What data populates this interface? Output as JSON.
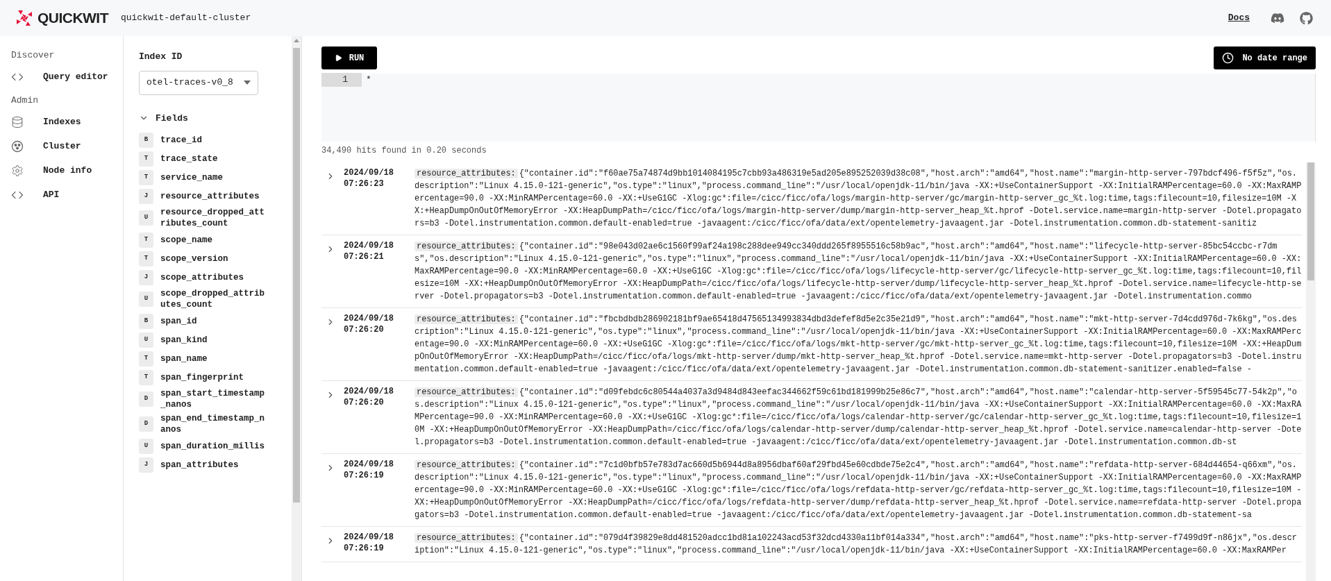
{
  "header": {
    "brand": "QUICKWIT",
    "cluster": "quickwit-default-cluster",
    "docs": "Docs"
  },
  "nav": [
    {
      "title": "Discover",
      "items": [
        {
          "label": "Query editor"
        }
      ]
    },
    {
      "title": "Admin",
      "items": [
        {
          "label": "Indexes"
        },
        {
          "label": "Cluster"
        },
        {
          "label": "Node info"
        },
        {
          "label": "API"
        }
      ]
    }
  ],
  "index_panel": {
    "label": "Index ID",
    "value": "otel-traces-v0_8",
    "fields_title": "Fields",
    "fields_expanded": true,
    "fields": [
      {
        "type": "B",
        "name": "trace_id"
      },
      {
        "type": "T",
        "name": "trace_state"
      },
      {
        "type": "T",
        "name": "service_name"
      },
      {
        "type": "J",
        "name": "resource_attributes"
      },
      {
        "type": "U",
        "name": "resource_dropped_attributes_count"
      },
      {
        "type": "T",
        "name": "scope_name"
      },
      {
        "type": "T",
        "name": "scope_version"
      },
      {
        "type": "J",
        "name": "scope_attributes"
      },
      {
        "type": "U",
        "name": "scope_dropped_attributes_count"
      },
      {
        "type": "B",
        "name": "span_id"
      },
      {
        "type": "U",
        "name": "span_kind"
      },
      {
        "type": "T",
        "name": "span_name"
      },
      {
        "type": "T",
        "name": "span_fingerprint"
      },
      {
        "type": "D",
        "name": "span_start_timestamp_nanos"
      },
      {
        "type": "D",
        "name": "span_end_timestamp_nanos"
      },
      {
        "type": "U",
        "name": "span_duration_millis"
      },
      {
        "type": "J",
        "name": "span_attributes"
      }
    ]
  },
  "query": {
    "run_label": "RUN",
    "date_range": "No date range",
    "lines": [
      {
        "number": "1",
        "text": "*"
      }
    ]
  },
  "hits": "34,490 hits found in 0.20 seconds",
  "results": [
    {
      "date": "2024/09/18",
      "time": "07:26:23",
      "key": "resource_attributes:",
      "value": "{\"container.id\":\"f60ae75a74874d9bb1014084195c7cbb93a486319e5ad205e895252039d38c08\",\"host.arch\":\"amd64\",\"host.name\":\"margin-http-server-797bdcf496-f5f5z\",\"os.description\":\"Linux 4.15.0-121-generic\",\"os.type\":\"linux\",\"process.command_line\":\"/usr/local/openjdk-11/bin/java -XX:+UseContainerSupport -XX:InitialRAMPercentage=60.0 -XX:MaxRAMPercentage=90.0 -XX:MinRAMPercentage=60.0 -XX:+UseG1GC -Xlog:gc*:file=/cicc/ficc/ofa/logs/margin-http-server/gc/margin-http-server_gc_%t.log:time,tags:filecount=10,filesize=10M -XX:+HeapDumpOnOutOfMemoryError -XX:HeapDumpPath=/cicc/ficc/ofa/logs/margin-http-server/dump/margin-http-server_heap_%t.hprof -Dotel.service.name=margin-http-server -Dotel.propagators=b3 -Dotel.instrumentation.common.default-enabled=true -javaagent:/cicc/ficc/ofa/data/ext/opentelemetry-javaagent.jar -Dotel.instrumentation.common.db-statement-sanitiz"
    },
    {
      "date": "2024/09/18",
      "time": "07:26:21",
      "key": "resource_attributes:",
      "value": "{\"container.id\":\"98e043d02ae6c1560f99af24a198c288dee949cc340ddd265f8955516c58b9ac\",\"host.arch\":\"amd64\",\"host.name\":\"lifecycle-http-server-85bc54ccbc-r7dms\",\"os.description\":\"Linux 4.15.0-121-generic\",\"os.type\":\"linux\",\"process.command_line\":\"/usr/local/openjdk-11/bin/java -XX:+UseContainerSupport -XX:InitialRAMPercentage=60.0 -XX:MaxRAMPercentage=90.0 -XX:MinRAMPercentage=60.0 -XX:+UseG1GC -Xlog:gc*:file=/cicc/ficc/ofa/logs/lifecycle-http-server/gc/lifecycle-http-server_gc_%t.log:time,tags:filecount=10,filesize=10M -XX:+HeapDumpOnOutOfMemoryError -XX:HeapDumpPath=/cicc/ficc/ofa/logs/lifecycle-http-server/dump/lifecycle-http-server_heap_%t.hprof -Dotel.service.name=lifecycle-http-server -Dotel.propagators=b3 -Dotel.instrumentation.common.default-enabled=true -javaagent:/cicc/ficc/ofa/data/ext/opentelemetry-javaagent.jar -Dotel.instrumentation.commo"
    },
    {
      "date": "2024/09/18",
      "time": "07:26:20",
      "key": "resource_attributes:",
      "value": "{\"container.id\":\"fbcbdbdb286902181bf9ae65418d47565134993834dbd3defef8d5e2c35e21d9\",\"host.arch\":\"amd64\",\"host.name\":\"mkt-http-server-7d4cdd976d-7k6kg\",\"os.description\":\"Linux 4.15.0-121-generic\",\"os.type\":\"linux\",\"process.command_line\":\"/usr/local/openjdk-11/bin/java -XX:+UseContainerSupport -XX:InitialRAMPercentage=60.0 -XX:MaxRAMPercentage=90.0 -XX:MinRAMPercentage=60.0 -XX:+UseG1GC -Xlog:gc*:file=/cicc/ficc/ofa/logs/mkt-http-server/gc/mkt-http-server_gc_%t.log:time,tags:filecount=10,filesize=10M -XX:+HeapDumpOnOutOfMemoryError -XX:HeapDumpPath=/cicc/ficc/ofa/logs/mkt-http-server/dump/mkt-http-server_heap_%t.hprof -Dotel.service.name=mkt-http-server -Dotel.propagators=b3 -Dotel.instrumentation.common.default-enabled=true -javaagent:/cicc/ficc/ofa/data/ext/opentelemetry-javaagent.jar -Dotel.instrumentation.common.db-statement-sanitizer.enabled=false -"
    },
    {
      "date": "2024/09/18",
      "time": "07:26:20",
      "key": "resource_attributes:",
      "value": "{\"container.id\":\"d09febdc6c80544a4037a3d9484d843eefac344662f59c61bd181999b25e86c7\",\"host.arch\":\"amd64\",\"host.name\":\"calendar-http-server-5f59545c77-54k2p\",\"os.description\":\"Linux 4.15.0-121-generic\",\"os.type\":\"linux\",\"process.command_line\":\"/usr/local/openjdk-11/bin/java -XX:+UseContainerSupport -XX:InitialRAMPercentage=60.0 -XX:MaxRAMPercentage=90.0 -XX:MinRAMPercentage=60.0 -XX:+UseG1GC -Xlog:gc*:file=/cicc/ficc/ofa/logs/calendar-http-server/gc/calendar-http-server_gc_%t.log:time,tags:filecount=10,filesize=10M -XX:+HeapDumpOnOutOfMemoryError -XX:HeapDumpPath=/cicc/ficc/ofa/logs/calendar-http-server/dump/calendar-http-server_heap_%t.hprof -Dotel.service.name=calendar-http-server -Dotel.propagators=b3 -Dotel.instrumentation.common.default-enabled=true -javaagent:/cicc/ficc/ofa/data/ext/opentelemetry-javaagent.jar -Dotel.instrumentation.common.db-st"
    },
    {
      "date": "2024/09/18",
      "time": "07:26:19",
      "key": "resource_attributes:",
      "value": "{\"container.id\":\"7c1d0bfb57e783d7ac660d5b6944d8a8956dbaf60af29fbd45e60cdbde75e2c4\",\"host.arch\":\"amd64\",\"host.name\":\"refdata-http-server-684d44654-q66xm\",\"os.description\":\"Linux 4.15.0-121-generic\",\"os.type\":\"linux\",\"process.command_line\":\"/usr/local/openjdk-11/bin/java -XX:+UseContainerSupport -XX:InitialRAMPercentage=60.0 -XX:MaxRAMPercentage=90.0 -XX:MinRAMPercentage=60.0 -XX:+UseG1GC -Xlog:gc*:file=/cicc/ficc/ofa/logs/refdata-http-server/gc/refdata-http-server_gc_%t.log:time,tags:filecount=10,filesize=10M -XX:+HeapDumpOnOutOfMemoryError -XX:HeapDumpPath=/cicc/ficc/ofa/logs/refdata-http-server/dump/refdata-http-server_heap_%t.hprof -Dotel.service.name=refdata-http-server -Dotel.propagators=b3 -Dotel.instrumentation.common.default-enabled=true -javaagent:/cicc/ficc/ofa/data/ext/opentelemetry-javaagent.jar -Dotel.instrumentation.common.db-statement-sa"
    },
    {
      "date": "2024/09/18",
      "time": "07:26:19",
      "key": "resource_attributes:",
      "value": "{\"container.id\":\"079d4f39829e8dd481520adcc1bd81a102243acd53f32dcd4330a11bf014a334\",\"host.arch\":\"amd64\",\"host.name\":\"pks-http-server-f7499d9f-n86jx\",\"os.description\":\"Linux 4.15.0-121-generic\",\"os.type\":\"linux\",\"process.command_line\":\"/usr/local/openjdk-11/bin/java -XX:+UseContainerSupport -XX:InitialRAMPercentage=60.0 -XX:MaxRAMPer"
    }
  ]
}
